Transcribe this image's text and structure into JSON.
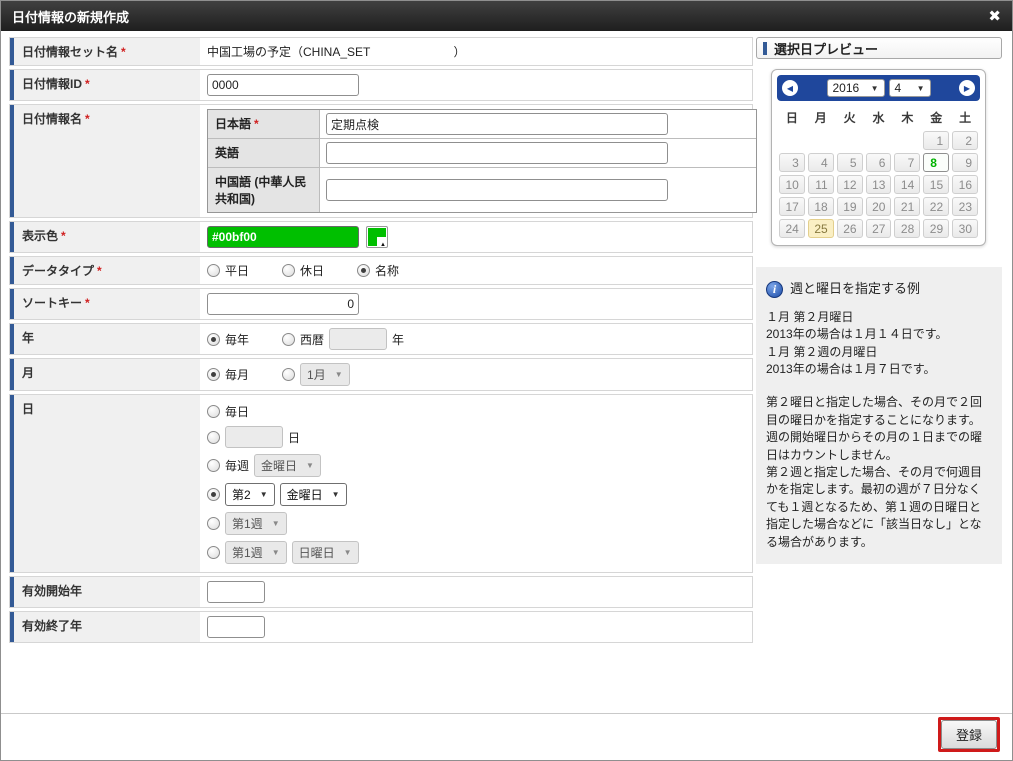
{
  "window": {
    "title": "日付情報の新規作成",
    "close_icon": "✖"
  },
  "ui": {
    "arrow": "▼",
    "required_mark": "*"
  },
  "form": {
    "set_name": {
      "label": "日付情報セット名",
      "value": "中国工場の予定（CHINA_SET                         ）"
    },
    "info_id": {
      "label": "日付情報ID",
      "value": "0000"
    },
    "info_name": {
      "label": "日付情報名",
      "ja": {
        "label": "日本語",
        "value": "定期点検"
      },
      "en": {
        "label": "英語",
        "value": ""
      },
      "zh": {
        "label": "中国語 (中華人民共和国)",
        "value": ""
      }
    },
    "display_color": {
      "label": "表示色",
      "value": "#00bf00",
      "hex": "#00bf00"
    },
    "data_type": {
      "label": "データタイプ",
      "options": [
        {
          "label": "平日",
          "checked": false
        },
        {
          "label": "休日",
          "checked": false
        },
        {
          "label": "名称",
          "checked": true
        }
      ]
    },
    "sort_key": {
      "label": "ソートキー",
      "value": "0"
    },
    "year": {
      "label": "年",
      "every_label": "毎年",
      "every_checked": true,
      "western_label": "西暦",
      "western_checked": false,
      "western_value": "",
      "unit": "年"
    },
    "month": {
      "label": "月",
      "every_label": "毎月",
      "every_checked": true,
      "select_checked": false,
      "select_value": "1月"
    },
    "day": {
      "label": "日",
      "opt_every": {
        "checked": false,
        "label": "毎日"
      },
      "opt_date": {
        "checked": false,
        "value": "",
        "unit": "日"
      },
      "opt_weekly": {
        "checked": false,
        "label": "毎週",
        "dow": "金曜日"
      },
      "opt_nth_dow": {
        "checked": true,
        "nth": "第2",
        "dow": "金曜日"
      },
      "opt_nth_week": {
        "checked": false,
        "week": "第1週"
      },
      "opt_week_dow": {
        "checked": false,
        "week": "第1週",
        "dow": "日曜日"
      }
    },
    "valid_start": {
      "label": "有効開始年",
      "value": ""
    },
    "valid_end": {
      "label": "有効終了年",
      "value": ""
    }
  },
  "preview": {
    "title": "選択日プレビュー",
    "calendar": {
      "prev_icon": "◀",
      "next_icon": "▶",
      "year": "2016",
      "month": "4",
      "dow": [
        "日",
        "月",
        "火",
        "水",
        "木",
        "金",
        "土"
      ],
      "weeks": [
        [
          "",
          "",
          "",
          "",
          "",
          "1",
          "2"
        ],
        [
          "3",
          "4",
          "5",
          "6",
          "7",
          "8",
          "9"
        ],
        [
          "10",
          "11",
          "12",
          "13",
          "14",
          "15",
          "16"
        ],
        [
          "17",
          "18",
          "19",
          "20",
          "21",
          "22",
          "23"
        ],
        [
          "24",
          "25",
          "26",
          "27",
          "28",
          "29",
          "30"
        ]
      ],
      "selected_day": "8",
      "today_day": "25"
    },
    "note": {
      "icon": "i",
      "title": "週と曜日を指定する例",
      "example_lines": [
        "１月 第２月曜日",
        "2013年の場合は１月１４日です。",
        "１月 第２週の月曜日",
        "2013年の場合は１月７日です。"
      ],
      "body_lines": [
        "第２曜日と指定した場合、その月で２回目の曜日かを指定することになります。",
        "週の開始曜日からその月の１日までの曜日はカウントしません。",
        "第２週と指定した場合、その月で何週目かを指定します。最初の週が７日分なくても１週となるため、第１週の日曜日と指定した場合などに「該当日なし」となる場合があります。"
      ]
    }
  },
  "footer": {
    "submit_label": "登録"
  },
  "colors": {
    "display_color": "#00bf00",
    "selected_day_text": "#00b300",
    "today_bg": "#faefc4",
    "calendar_header": "#1f479c",
    "accent_bar": "#335a96",
    "annotation": "#cf1a1a"
  }
}
